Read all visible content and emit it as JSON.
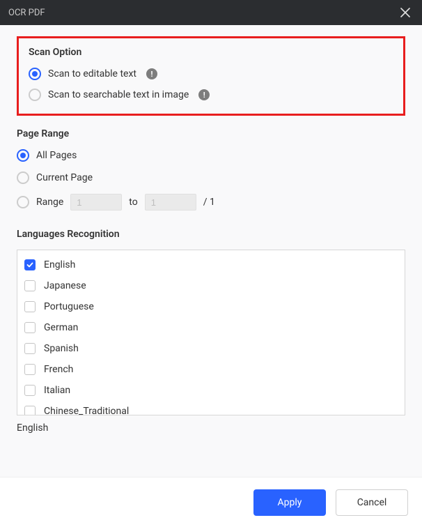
{
  "window": {
    "title": "OCR PDF"
  },
  "scan_option": {
    "heading": "Scan Option",
    "options": [
      {
        "label": "Scan to editable text",
        "selected": true
      },
      {
        "label": "Scan to searchable text in image",
        "selected": false
      }
    ]
  },
  "page_range": {
    "heading": "Page Range",
    "all_pages_label": "All Pages",
    "current_page_label": "Current Page",
    "range_label": "Range",
    "range_from": "1",
    "range_to": "1",
    "to_label": "to",
    "total_label": "/ 1",
    "selected": "all"
  },
  "languages": {
    "heading": "Languages Recognition",
    "items": [
      {
        "label": "English",
        "checked": true
      },
      {
        "label": "Japanese",
        "checked": false
      },
      {
        "label": "Portuguese",
        "checked": false
      },
      {
        "label": "German",
        "checked": false
      },
      {
        "label": "Spanish",
        "checked": false
      },
      {
        "label": "French",
        "checked": false
      },
      {
        "label": "Italian",
        "checked": false
      },
      {
        "label": "Chinese_Traditional",
        "checked": false
      }
    ],
    "selected_summary": "English"
  },
  "footer": {
    "apply_label": "Apply",
    "cancel_label": "Cancel"
  }
}
